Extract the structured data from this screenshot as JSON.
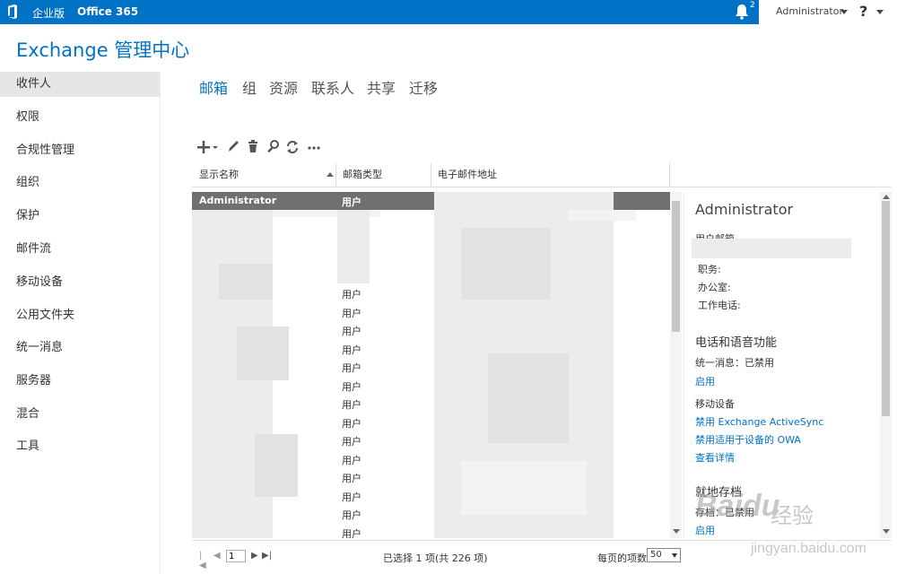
{
  "topbar": {
    "edition": "企业版",
    "product": "Office 365",
    "notification_count": "2",
    "user": "Administrator",
    "help": "?"
  },
  "app_title": "Exchange 管理中心",
  "sidebar": {
    "items": [
      {
        "label": "收件人",
        "active": true
      },
      {
        "label": "权限"
      },
      {
        "label": "合规性管理"
      },
      {
        "label": "组织"
      },
      {
        "label": "保护"
      },
      {
        "label": "邮件流"
      },
      {
        "label": "移动设备"
      },
      {
        "label": "公用文件夹"
      },
      {
        "label": "统一消息"
      },
      {
        "label": "服务器"
      },
      {
        "label": "混合"
      },
      {
        "label": "工具"
      }
    ]
  },
  "tabs": [
    {
      "label": "邮箱",
      "active": true
    },
    {
      "label": "组"
    },
    {
      "label": "资源"
    },
    {
      "label": "联系人"
    },
    {
      "label": "共享"
    },
    {
      "label": "迁移"
    }
  ],
  "toolbar": {
    "icons": [
      "add-icon",
      "edit-icon",
      "delete-icon",
      "search-icon",
      "refresh-icon",
      "more-icon"
    ]
  },
  "table": {
    "columns": [
      "显示名称",
      "邮箱类型",
      "电子邮件地址"
    ],
    "selected_row": {
      "name": "Administrator",
      "type": "用户"
    },
    "visible_types": [
      "用户",
      "用户",
      "用户",
      "用户",
      "用户",
      "用户",
      "用户",
      "用户",
      "用户",
      "用户",
      "用户",
      "用户",
      "用户",
      "用户"
    ]
  },
  "details": {
    "name": "Administrator",
    "mailbox_label": "用户邮箱",
    "title_label": "职务:",
    "office_label": "办公室:",
    "phone_label": "工作电话:",
    "voice_section": "电话和语音功能",
    "um_status": "统一消息：已禁用",
    "enable_link": "启用",
    "mobile_label": "移动设备",
    "disable_activesync": "禁用 Exchange ActiveSync",
    "disable_owa": "禁用适用于设备的 OWA",
    "view_details": "查看详情",
    "archive_section": "就地存档",
    "archive_status": "存档：已禁用",
    "archive_enable": "启用"
  },
  "footer": {
    "page_value": "1",
    "selection_info": "已选择 1 项(共 226 项)",
    "per_page_label": "每页的项数",
    "per_page_value": "50"
  },
  "watermark": {
    "brand": "Baidu",
    "cn": "经验",
    "url": "jingyan.baidu.com"
  },
  "colors": {
    "accent": "#0072c6",
    "selected_row": "#707070"
  }
}
